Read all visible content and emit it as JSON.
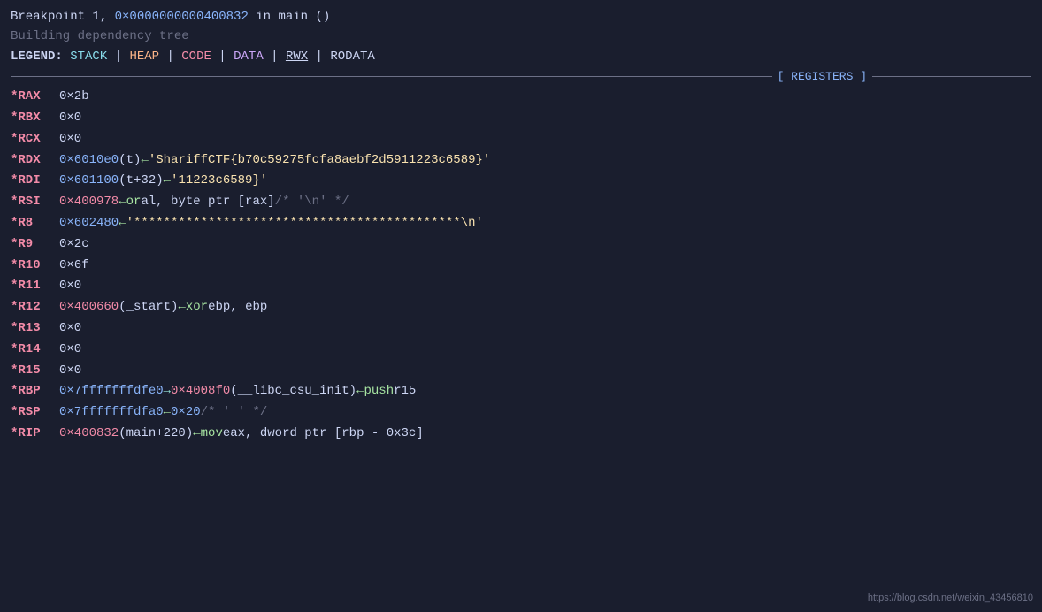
{
  "terminal": {
    "breakpoint_line": {
      "text1": "Breakpoint 1, ",
      "addr": "0×0000000000400832",
      "text2": " in ",
      "func": "main",
      "text3": " ()"
    },
    "building_line": "Building dependency tree",
    "legend": {
      "label": "LEGEND: ",
      "items": [
        "STACK",
        "|",
        "HEAP",
        "|",
        "CODE",
        "|",
        "DATA",
        "|",
        "RWX",
        "|",
        "RODATA"
      ]
    },
    "registers_header": "[ REGISTERS ]",
    "registers": [
      {
        "name": "*RAX",
        "value": "0×2b",
        "value_color": "white",
        "rest": ""
      },
      {
        "name": "*RBX",
        "value": "0×0",
        "value_color": "white",
        "rest": ""
      },
      {
        "name": "*RCX",
        "value": "0×0",
        "value_color": "white",
        "rest": ""
      },
      {
        "name": "*RDX",
        "addr": "0×6010e0",
        "extra": " (t)",
        "arrow": " ← ",
        "string": "'ShariffCTF{b70c59275fcfa8aebf2d5911223c6589}'"
      },
      {
        "name": "*RDI",
        "addr": "0×601100",
        "extra": " (t+32)",
        "arrow": " ← ",
        "string": "'11223c6589}'"
      },
      {
        "name": "*RSI",
        "addr": "0×400978",
        "arrow": " ← ",
        "asm_kw": "or",
        "asm_middle": "       al, byte ptr [rax]",
        "comment": " /* '\\n' */"
      },
      {
        "name": "*R8",
        "addr": "0×602480",
        "arrow": " ← ",
        "string": "'********************************************\\n'"
      },
      {
        "name": "*R9",
        "value": "0×2c",
        "value_color": "white",
        "rest": ""
      },
      {
        "name": "*R10",
        "value": "0×6f",
        "value_color": "white",
        "rest": ""
      },
      {
        "name": "*R11",
        "value": "0×0",
        "value_color": "white",
        "rest": ""
      },
      {
        "name": "*R12",
        "addr": "0×400660",
        "extra": " (_start)",
        "arrow": " ← ",
        "asm_kw": "xor",
        "asm_rest": "     ebp, ebp"
      },
      {
        "name": "*R13",
        "value": "0×0",
        "value_color": "white",
        "rest": ""
      },
      {
        "name": "*R14",
        "value": "0×0",
        "value_color": "white",
        "rest": ""
      },
      {
        "name": "*R15",
        "value": "0×0",
        "value_color": "white",
        "rest": ""
      },
      {
        "name": "*RBP",
        "addr1": "0×7fffffffdfe0",
        "arrow1": " → ",
        "addr2": "0×4008f0",
        "extra2": " (__libc_csu_init)",
        "arrow2": " ← ",
        "asm_kw": "push",
        "asm_rest": "   r15"
      },
      {
        "name": "*RSP",
        "addr": "0×7fffffffdfа0",
        "arrow": " ← ",
        "value2": "0×20",
        "comment": " /* ' ' */"
      },
      {
        "name": "*RIP",
        "addr": "0×400832",
        "extra": " (main+220)",
        "arrow": " ← ",
        "asm_kw": "mov",
        "asm_rest": "     eax, dword ptr [rbp - 0x3c]"
      }
    ],
    "watermark": "https://blog.csdn.net/weixin_43456810"
  }
}
